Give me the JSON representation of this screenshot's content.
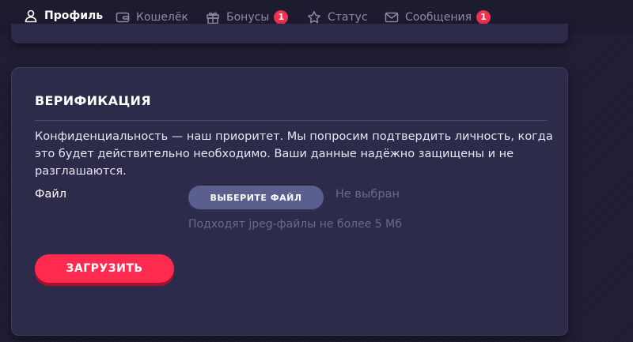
{
  "tabs": [
    {
      "label": "Профиль",
      "icon": "user-icon",
      "active": true
    },
    {
      "label": "Кошелёк",
      "icon": "wallet-icon"
    },
    {
      "label": "Бонусы",
      "icon": "gift-icon",
      "badge": "1"
    },
    {
      "label": "Статус",
      "icon": "star-icon"
    },
    {
      "label": "Сообщения",
      "icon": "mail-icon",
      "badge": "1"
    }
  ],
  "verification": {
    "title": "ВЕРИФИКАЦИЯ",
    "description": "Конфиденциальность — наш приоритет. Мы попросим подтвердить личность, когда это будет действительно необходимо. Ваши данные надёжно защищены и не разглашаются.",
    "file_label": "Файл",
    "choose_button": "ВЫБЕРИТЕ ФАЙЛ",
    "file_status": "Не выбран",
    "hint": "Подходят jpeg-файлы не более 5 Мб",
    "upload_button": "ЗАГРУЗИТЬ"
  },
  "colors": {
    "page_background": "#1f1d33",
    "card_background": "#2c2b4a",
    "accent": "#ff2a4f",
    "badge": "#f0314f",
    "secondary_button": "#5a5f8d"
  }
}
